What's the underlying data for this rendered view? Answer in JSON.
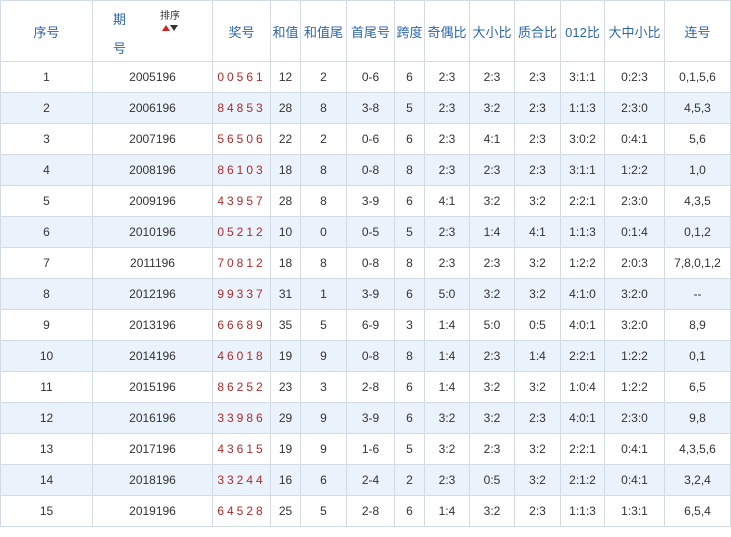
{
  "headers": {
    "seq": "序号",
    "period_top": "期",
    "period_bottom": "号",
    "sort_label": "排序",
    "award": "奖号",
    "sum": "和值",
    "sum_tail": "和值尾",
    "first_last": "首尾号",
    "span": "跨度",
    "odd_even": "奇偶比",
    "big_small": "大小比",
    "prime_comp": "质合比",
    "ratio_012": "012比",
    "big_mid_small": "大中小比",
    "consecutive": "连号"
  },
  "colors": {
    "header_text": "#2d66b0",
    "award_text": "#b02a2a",
    "row_alt_bg": "#eaf3fc",
    "border": "#d3dbe6"
  },
  "rows": [
    {
      "seq": "1",
      "period": "2005196",
      "award": "00561",
      "sum": "12",
      "sum_tail": "2",
      "first_last": "0-6",
      "span": "6",
      "odd_even": "2:3",
      "big_small": "2:3",
      "prime_comp": "2:3",
      "ratio_012": "3:1:1",
      "big_mid_small": "0:2:3",
      "consecutive": "0,1,5,6"
    },
    {
      "seq": "2",
      "period": "2006196",
      "award": "84853",
      "sum": "28",
      "sum_tail": "8",
      "first_last": "3-8",
      "span": "5",
      "odd_even": "2:3",
      "big_small": "3:2",
      "prime_comp": "2:3",
      "ratio_012": "1:1:3",
      "big_mid_small": "2:3:0",
      "consecutive": "4,5,3"
    },
    {
      "seq": "3",
      "period": "2007196",
      "award": "56506",
      "sum": "22",
      "sum_tail": "2",
      "first_last": "0-6",
      "span": "6",
      "odd_even": "2:3",
      "big_small": "4:1",
      "prime_comp": "2:3",
      "ratio_012": "3:0:2",
      "big_mid_small": "0:4:1",
      "consecutive": "5,6"
    },
    {
      "seq": "4",
      "period": "2008196",
      "award": "86103",
      "sum": "18",
      "sum_tail": "8",
      "first_last": "0-8",
      "span": "8",
      "odd_even": "2:3",
      "big_small": "2:3",
      "prime_comp": "2:3",
      "ratio_012": "3:1:1",
      "big_mid_small": "1:2:2",
      "consecutive": "1,0"
    },
    {
      "seq": "5",
      "period": "2009196",
      "award": "43957",
      "sum": "28",
      "sum_tail": "8",
      "first_last": "3-9",
      "span": "6",
      "odd_even": "4:1",
      "big_small": "3:2",
      "prime_comp": "3:2",
      "ratio_012": "2:2:1",
      "big_mid_small": "2:3:0",
      "consecutive": "4,3,5"
    },
    {
      "seq": "6",
      "period": "2010196",
      "award": "05212",
      "sum": "10",
      "sum_tail": "0",
      "first_last": "0-5",
      "span": "5",
      "odd_even": "2:3",
      "big_small": "1:4",
      "prime_comp": "4:1",
      "ratio_012": "1:1:3",
      "big_mid_small": "0:1:4",
      "consecutive": "0,1,2"
    },
    {
      "seq": "7",
      "period": "2011196",
      "award": "70812",
      "sum": "18",
      "sum_tail": "8",
      "first_last": "0-8",
      "span": "8",
      "odd_even": "2:3",
      "big_small": "2:3",
      "prime_comp": "3:2",
      "ratio_012": "1:2:2",
      "big_mid_small": "2:0:3",
      "consecutive": "7,8,0,1,2"
    },
    {
      "seq": "8",
      "period": "2012196",
      "award": "99337",
      "sum": "31",
      "sum_tail": "1",
      "first_last": "3-9",
      "span": "6",
      "odd_even": "5:0",
      "big_small": "3:2",
      "prime_comp": "3:2",
      "ratio_012": "4:1:0",
      "big_mid_small": "3:2:0",
      "consecutive": "--"
    },
    {
      "seq": "9",
      "period": "2013196",
      "award": "66689",
      "sum": "35",
      "sum_tail": "5",
      "first_last": "6-9",
      "span": "3",
      "odd_even": "1:4",
      "big_small": "5:0",
      "prime_comp": "0:5",
      "ratio_012": "4:0:1",
      "big_mid_small": "3:2:0",
      "consecutive": "8,9"
    },
    {
      "seq": "10",
      "period": "2014196",
      "award": "46018",
      "sum": "19",
      "sum_tail": "9",
      "first_last": "0-8",
      "span": "8",
      "odd_even": "1:4",
      "big_small": "2:3",
      "prime_comp": "1:4",
      "ratio_012": "2:2:1",
      "big_mid_small": "1:2:2",
      "consecutive": "0,1"
    },
    {
      "seq": "11",
      "period": "2015196",
      "award": "86252",
      "sum": "23",
      "sum_tail": "3",
      "first_last": "2-8",
      "span": "6",
      "odd_even": "1:4",
      "big_small": "3:2",
      "prime_comp": "3:2",
      "ratio_012": "1:0:4",
      "big_mid_small": "1:2:2",
      "consecutive": "6,5"
    },
    {
      "seq": "12",
      "period": "2016196",
      "award": "33986",
      "sum": "29",
      "sum_tail": "9",
      "first_last": "3-9",
      "span": "6",
      "odd_even": "3:2",
      "big_small": "3:2",
      "prime_comp": "2:3",
      "ratio_012": "4:0:1",
      "big_mid_small": "2:3:0",
      "consecutive": "9,8"
    },
    {
      "seq": "13",
      "period": "2017196",
      "award": "43615",
      "sum": "19",
      "sum_tail": "9",
      "first_last": "1-6",
      "span": "5",
      "odd_even": "3:2",
      "big_small": "2:3",
      "prime_comp": "3:2",
      "ratio_012": "2:2:1",
      "big_mid_small": "0:4:1",
      "consecutive": "4,3,5,6"
    },
    {
      "seq": "14",
      "period": "2018196",
      "award": "33244",
      "sum": "16",
      "sum_tail": "6",
      "first_last": "2-4",
      "span": "2",
      "odd_even": "2:3",
      "big_small": "0:5",
      "prime_comp": "3:2",
      "ratio_012": "2:1:2",
      "big_mid_small": "0:4:1",
      "consecutive": "3,2,4"
    },
    {
      "seq": "15",
      "period": "2019196",
      "award": "64528",
      "sum": "25",
      "sum_tail": "5",
      "first_last": "2-8",
      "span": "6",
      "odd_even": "1:4",
      "big_small": "3:2",
      "prime_comp": "2:3",
      "ratio_012": "1:1:3",
      "big_mid_small": "1:3:1",
      "consecutive": "6,5,4"
    }
  ]
}
